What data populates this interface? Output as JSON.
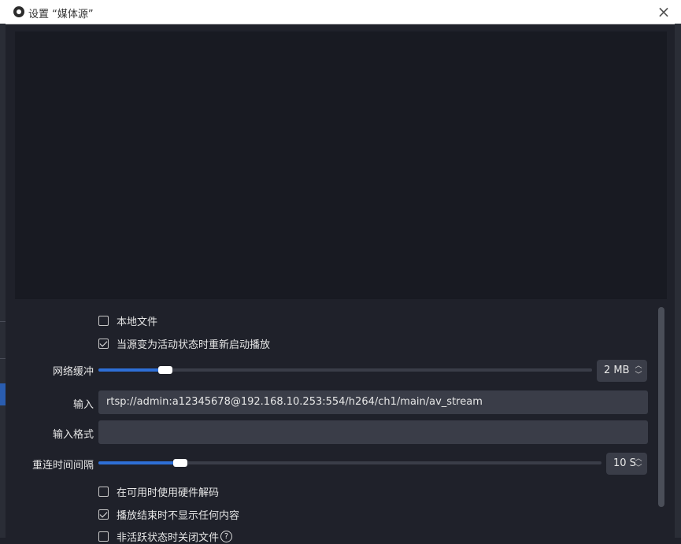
{
  "window": {
    "title": "设置 “媒体源”"
  },
  "checkboxes": {
    "local_file": {
      "label": "本地文件",
      "checked": false
    },
    "restart_on_activate": {
      "label": "当源变为活动状态时重新启动播放",
      "checked": true
    },
    "hw_decode": {
      "label": "在可用时使用硬件解码",
      "checked": false
    },
    "hide_when_ended": {
      "label": "播放结束时不显示任何内容",
      "checked": true
    },
    "close_inactive": {
      "label": "非活跃状态时关闭文件",
      "checked": false
    }
  },
  "network_buffer": {
    "label": "网络缓冲",
    "value_text": "2 MB",
    "fraction": 0.135
  },
  "input": {
    "label": "输入",
    "value": "rtsp://admin:a12345678@192.168.10.253:554/h264/ch1/main/av_stream"
  },
  "input_format": {
    "label": "输入格式",
    "value": ""
  },
  "reconnect": {
    "label": "重连时间间隔",
    "value_text": "10 S",
    "fraction": 0.162
  },
  "colors": {
    "accent": "#2e6fd6",
    "background": "#1f212a"
  }
}
